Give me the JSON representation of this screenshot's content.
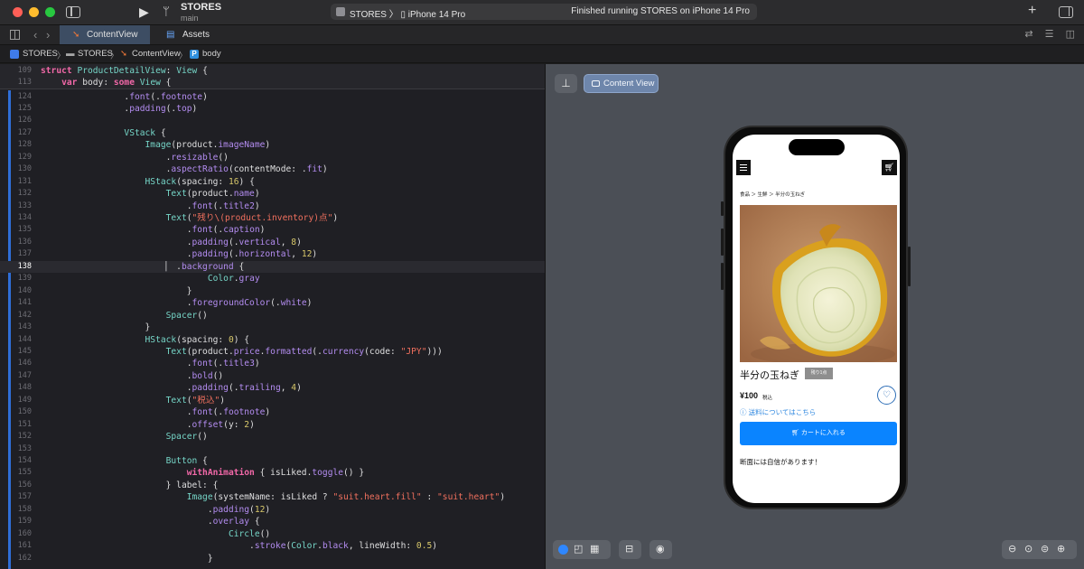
{
  "window": {
    "project_name": "STORES",
    "branch": "main",
    "scheme": "STORES 〉 ▯ iPhone 14 Pro",
    "status": "Finished running STORES on iPhone 14 Pro"
  },
  "tabs": [
    {
      "label": "ContentView",
      "icon": "swift-icon"
    },
    {
      "label": "Assets",
      "icon": "assets-icon"
    }
  ],
  "jumpbar": {
    "project": "STORES",
    "folder": "STORES",
    "file": "ContentView",
    "symbol": "body",
    "symbol_badge": "P"
  },
  "code": {
    "sticky_lines": [
      {
        "n": "109",
        "text": "struct ProductDetailView: View {"
      },
      {
        "n": "113",
        "text": "    var body: some View {"
      }
    ],
    "lines": [
      {
        "n": "124",
        "text": "                .font(.footnote)"
      },
      {
        "n": "125",
        "text": "                .padding(.top)"
      },
      {
        "n": "126",
        "text": ""
      },
      {
        "n": "127",
        "text": "                VStack {"
      },
      {
        "n": "128",
        "text": "                    Image(product.imageName)"
      },
      {
        "n": "129",
        "text": "                        .resizable()"
      },
      {
        "n": "130",
        "text": "                        .aspectRatio(contentMode: .fit)"
      },
      {
        "n": "131",
        "text": "                    HStack(spacing: 16) {"
      },
      {
        "n": "132",
        "text": "                        Text(product.name)"
      },
      {
        "n": "133",
        "text": "                            .font(.title2)"
      },
      {
        "n": "134",
        "text": "                        Text(\"残り\\(product.inventory)点\")"
      },
      {
        "n": "135",
        "text": "                            .font(.caption)"
      },
      {
        "n": "136",
        "text": "                            .padding(.vertical, 8)"
      },
      {
        "n": "137",
        "text": "                            .padding(.horizontal, 12)"
      },
      {
        "n": "138",
        "text": "                        ▏ .background {"
      },
      {
        "n": "139",
        "text": "                                Color.gray"
      },
      {
        "n": "140",
        "text": "                            }"
      },
      {
        "n": "141",
        "text": "                            .foregroundColor(.white)"
      },
      {
        "n": "142",
        "text": "                        Spacer()"
      },
      {
        "n": "143",
        "text": "                    }"
      },
      {
        "n": "144",
        "text": "                    HStack(spacing: 0) {"
      },
      {
        "n": "145",
        "text": "                        Text(product.price.formatted(.currency(code: \"JPY\")))"
      },
      {
        "n": "146",
        "text": "                            .font(.title3)"
      },
      {
        "n": "147",
        "text": "                            .bold()"
      },
      {
        "n": "148",
        "text": "                            .padding(.trailing, 4)"
      },
      {
        "n": "149",
        "text": "                        Text(\"税込\")"
      },
      {
        "n": "150",
        "text": "                            .font(.footnote)"
      },
      {
        "n": "151",
        "text": "                            .offset(y: 2)"
      },
      {
        "n": "152",
        "text": "                        Spacer()"
      },
      {
        "n": "153",
        "text": ""
      },
      {
        "n": "154",
        "text": "                        Button {"
      },
      {
        "n": "155",
        "text": "                            withAnimation { isLiked.toggle() }"
      },
      {
        "n": "156",
        "text": "                        } label: {"
      },
      {
        "n": "157",
        "text": "                            Image(systemName: isLiked ? \"suit.heart.fill\" : \"suit.heart\")"
      },
      {
        "n": "158",
        "text": "                                .padding(12)"
      },
      {
        "n": "159",
        "text": "                                .overlay {"
      },
      {
        "n": "160",
        "text": "                                    Circle()"
      },
      {
        "n": "161",
        "text": "                                        .stroke(Color.black, lineWidth: 0.5)"
      },
      {
        "n": "162",
        "text": "                                }"
      }
    ],
    "current_line": "138"
  },
  "canvas": {
    "content_view_button": "Content View"
  },
  "preview": {
    "breadcrumb": "食品 ＞ 生鮮 ＞ 半分の玉ねぎ",
    "product_name": "半分の玉ねぎ",
    "inventory": "残り1点",
    "price": "¥100",
    "tax": "税込",
    "shipping_link": "送料についてはこちら",
    "add_to_cart": "カートに入れる",
    "description": "断面には自信があります！"
  },
  "colors": {
    "accent": "#0a84ff",
    "keyword": "#f268a8",
    "type": "#76d6c8",
    "string": "#f1705e",
    "number": "#d8c86a"
  }
}
